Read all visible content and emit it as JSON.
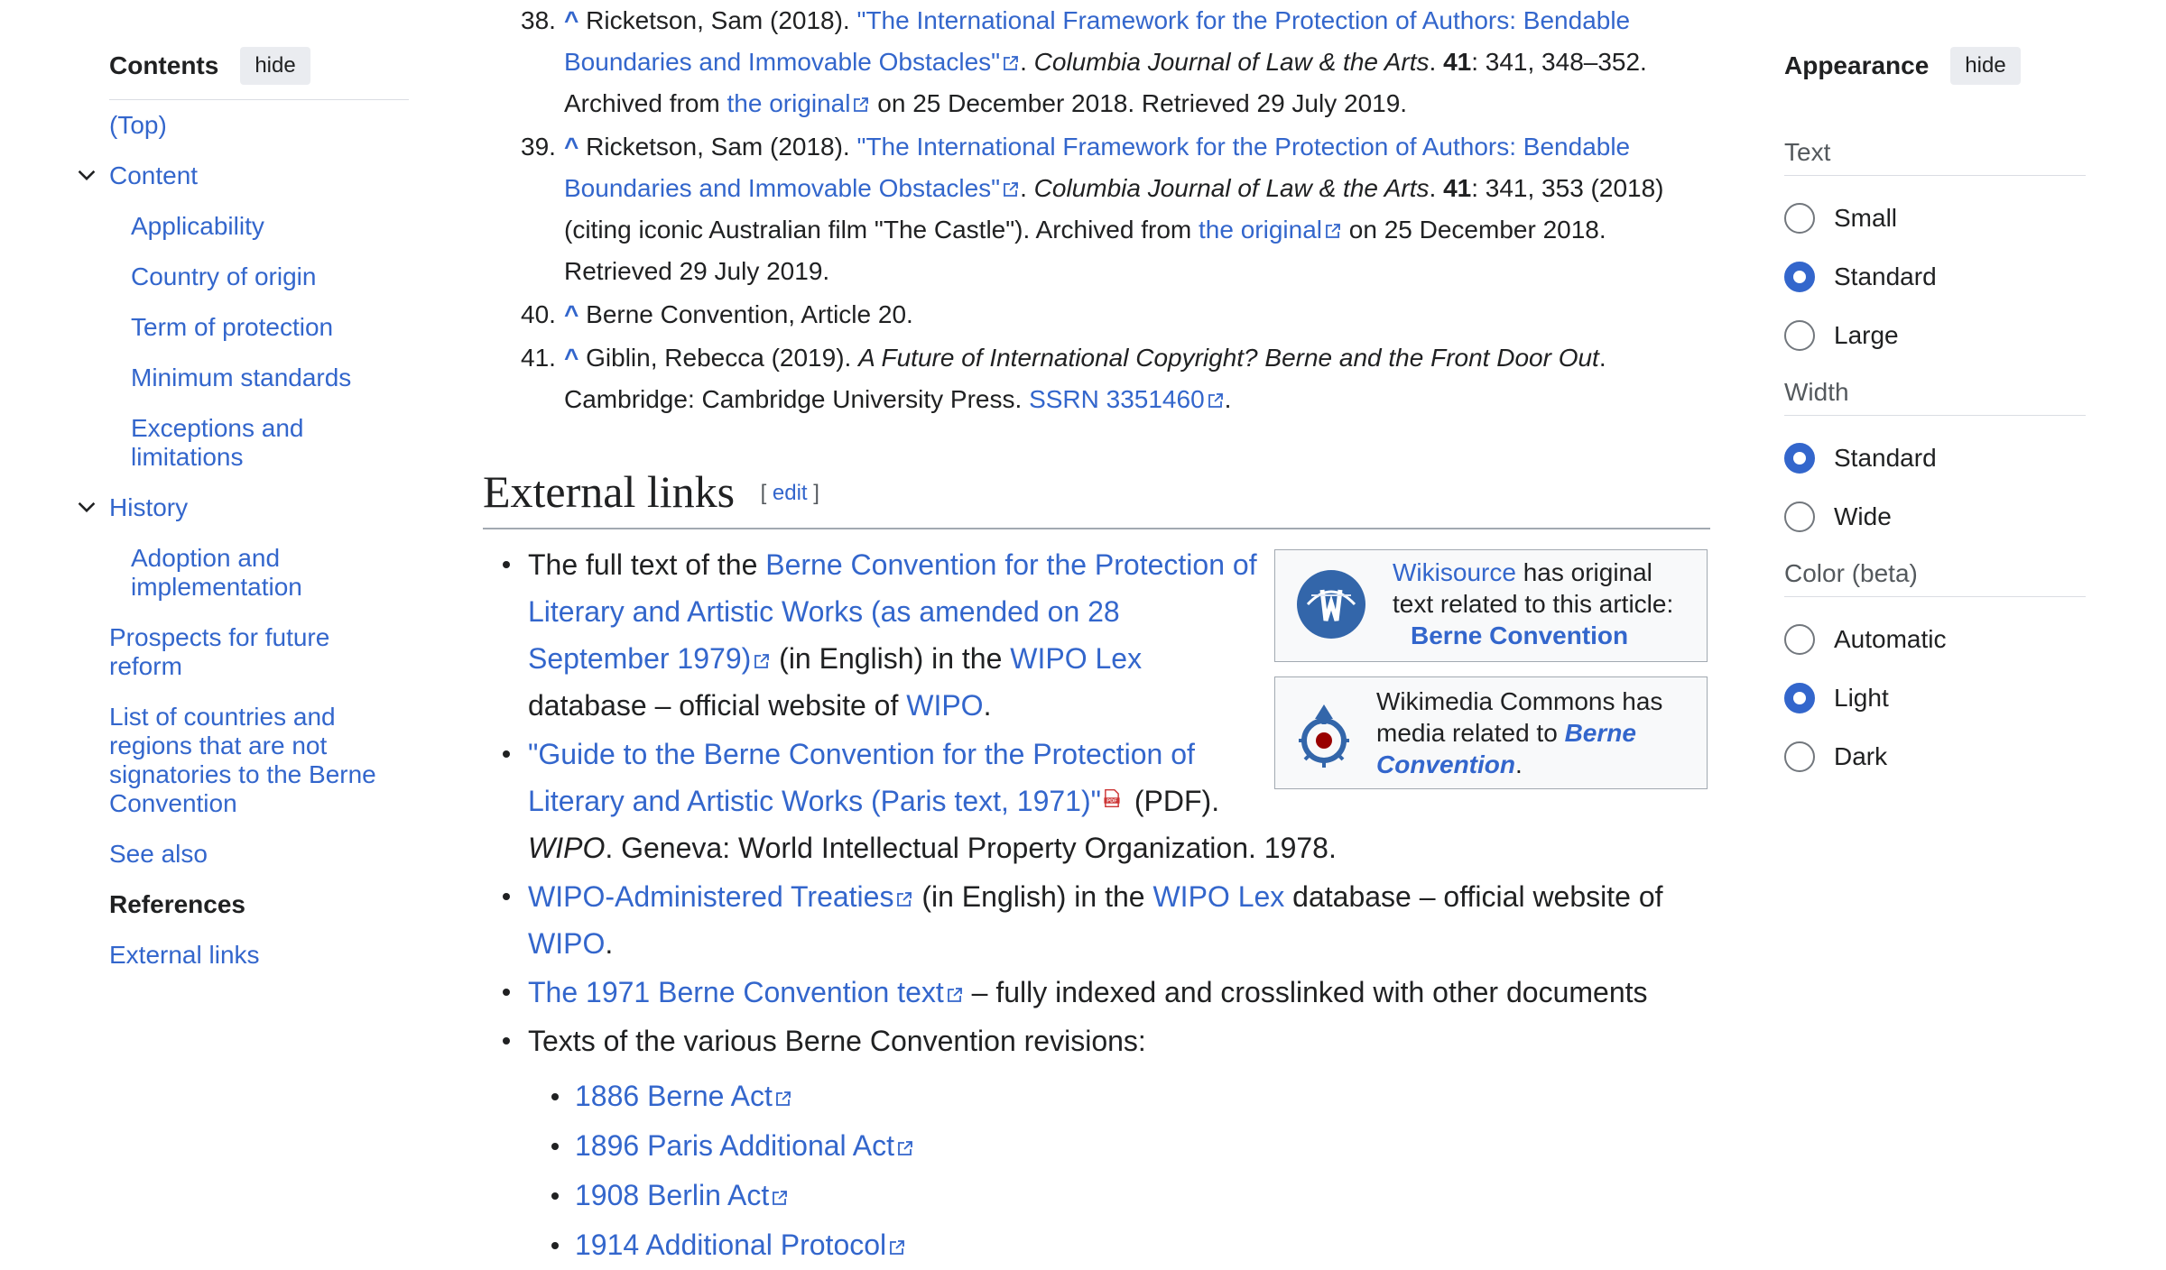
{
  "toc": {
    "title": "Contents",
    "hide_label": "hide",
    "items": [
      {
        "label": "(Top)"
      },
      {
        "label": "Content"
      },
      {
        "label": "Applicability"
      },
      {
        "label": "Country of origin"
      },
      {
        "label": "Term of protection"
      },
      {
        "label": "Minimum standards"
      },
      {
        "label": "Exceptions and limitations"
      },
      {
        "label": "History"
      },
      {
        "label": "Adoption and implementation"
      },
      {
        "label": "Prospects for future reform"
      },
      {
        "label": "List of countries and regions that are not signatories to the Berne Convention"
      },
      {
        "label": "See also"
      },
      {
        "label": "References"
      },
      {
        "label": "External links"
      }
    ]
  },
  "references": {
    "r38": {
      "num": "38.",
      "caret": "^",
      "author": "Ricketson, Sam (2018).",
      "title": "\"The International Framework for the Protection of Authors: Bendable Boundaries and Immovable Obstacles\"",
      "journal": "Columbia Journal of Law & the Arts",
      "vol": "41",
      "pages": ": 341, 348–352. Archived from ",
      "orig": "the original",
      "tail": " on 25 December 2018. Retrieved 29 July 2019."
    },
    "r39": {
      "num": "39.",
      "caret": "^",
      "author": "Ricketson, Sam (2018).",
      "title": "\"The International Framework for the Protection of Authors: Bendable Boundaries and Immovable Obstacles\"",
      "journal": "Columbia Journal of Law & the Arts",
      "vol": "41",
      "pages": ": 341, 353 (2018) (citing iconic Australian film \"The Castle\"). Archived from ",
      "orig": "the original",
      "tail": " on 25 December 2018. Retrieved 29 July 2019."
    },
    "r40": {
      "num": "40.",
      "caret": "^",
      "text": "Berne Convention, Article 20."
    },
    "r41": {
      "num": "41.",
      "caret": "^",
      "author": "Giblin, Rebecca (2019).",
      "book": "A Future of International Copyright? Berne and the Front Door Out",
      "pub": ". Cambridge: Cambridge University Press. ",
      "ssrn": "SSRN 3351460"
    }
  },
  "external_links": {
    "heading": "External links",
    "edit_open": "[ ",
    "edit_label": "edit",
    "edit_close": " ]",
    "item1": {
      "pre": "The full text of the ",
      "link": "Berne Convention for the Protection of Literary and Artistic Works (as amended on 28 September 1979)",
      "mid": " (in English) in the ",
      "lex": "WIPO Lex",
      "post": " database – official website of ",
      "wipo": "WIPO",
      "end": "."
    },
    "item2": {
      "link": "\"Guide to the Berne Convention for the Protection of Literary and Artistic Works (Paris text, 1971)\"",
      "pdf": " (PDF).",
      "pub": "WIPO",
      "rest": ". Geneva: World Intellectual Property Organization. 1978."
    },
    "item3": {
      "link": "WIPO-Administered Treaties",
      "mid": " (in English) in the ",
      "lex": "WIPO Lex",
      "post": " database – official website of ",
      "wipo": "WIPO",
      "end": "."
    },
    "item4": {
      "link": "The 1971 Berne Convention text",
      "post": " – fully indexed and crosslinked with other documents"
    },
    "item5": {
      "text": "Texts of the various Berne Convention revisions:",
      "sub": [
        "1886 Berne Act",
        "1896 Paris Additional Act",
        "1908 Berlin Act",
        "1914 Additional Protocol"
      ]
    }
  },
  "sister": {
    "wikisource": {
      "link": "Wikisource",
      "text1": " has original text related to this article:",
      "article": "Berne Convention"
    },
    "commons": {
      "text1": "Wikimedia Commons has media related to ",
      "link": "Berne Convention",
      "end": "."
    }
  },
  "appearance": {
    "title": "Appearance",
    "hide_label": "hide",
    "text_label": "Text",
    "text_options": [
      "Small",
      "Standard",
      "Large"
    ],
    "text_selected": "Standard",
    "width_label": "Width",
    "width_options": [
      "Standard",
      "Wide"
    ],
    "width_selected": "Standard",
    "color_label": "Color (beta)",
    "color_options": [
      "Automatic",
      "Light",
      "Dark"
    ],
    "color_selected": "Light"
  },
  "colors": {
    "link": "#3366cc",
    "text": "#202122",
    "muted": "#54595d",
    "border": "#a2a9b1"
  }
}
